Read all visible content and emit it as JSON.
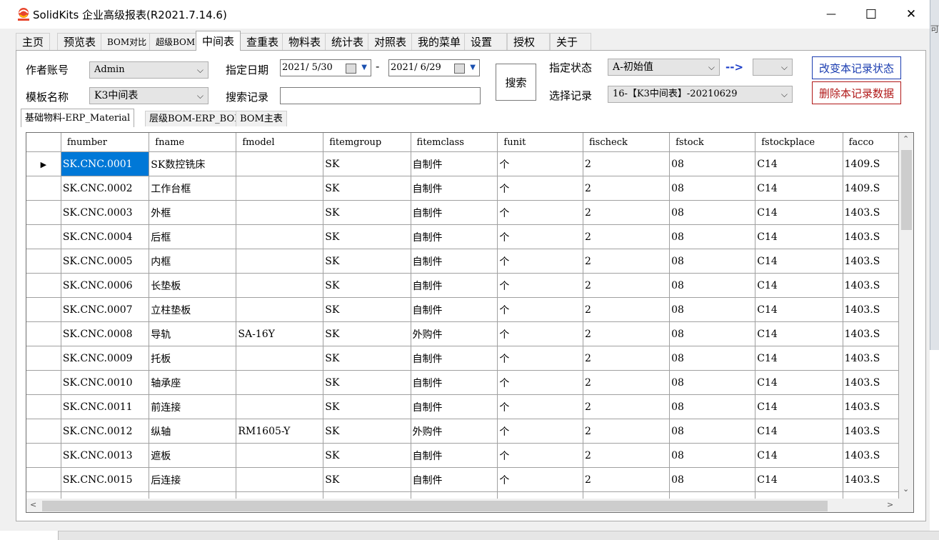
{
  "window": {
    "title": "SolidKits 企业高级报表(R2021.7.14.6)",
    "edge_text": "可",
    "minimize_glyph": "—",
    "maximize_glyph": "☐",
    "close_glyph": "✕"
  },
  "main_tabs": [
    {
      "label": "主页"
    },
    {
      "label": "预览表"
    },
    {
      "label": "BOM对比"
    },
    {
      "label": "超级BOM"
    },
    {
      "label": "中间表"
    },
    {
      "label": "查重表"
    },
    {
      "label": "物料表"
    },
    {
      "label": "统计表"
    },
    {
      "label": "对照表"
    },
    {
      "label": "我的菜单"
    },
    {
      "label": "设置"
    },
    {
      "label": "授权"
    },
    {
      "label": "关于"
    }
  ],
  "form": {
    "author_label": "作者账号",
    "author_value": "Admin",
    "template_label": "模板名称",
    "template_value": "K3中间表",
    "date_label": "指定日期",
    "date_from": "2021/ 5/30",
    "date_sep": "-",
    "date_to": "2021/ 6/29",
    "search_record_label": "搜索记录",
    "search_record_value": "",
    "search_button": "搜索",
    "status_label": "指定状态",
    "status_value": "A-初始值",
    "status_arrow": "-->",
    "status_target_value": "",
    "record_label": "选择记录",
    "record_value": "16-【K3中间表】-20210629",
    "change_status_button": "改变本记录状态",
    "delete_record_button": "删除本记录数据",
    "dropdown_arrow": "⌵"
  },
  "sub_tabs": [
    {
      "label": "基础物料-ERP_Material"
    },
    {
      "label": "层级BOM-ERP_BOM"
    },
    {
      "label": "BOM主表"
    }
  ],
  "grid": {
    "current_row_marker": "▶",
    "columns": [
      "fnumber",
      "fname",
      "fmodel",
      "fitemgroup",
      "fitemclass",
      "funit",
      "fischeck",
      "fstock",
      "fstockplace",
      "facco"
    ],
    "rows": [
      [
        "SK.CNC.0001",
        "SK数控铣床",
        "",
        "SK",
        "自制件",
        "个",
        "2",
        "08",
        "C14",
        "1409.S"
      ],
      [
        "SK.CNC.0002",
        "工作台框",
        "",
        "SK",
        "自制件",
        "个",
        "2",
        "08",
        "C14",
        "1409.S"
      ],
      [
        "SK.CNC.0003",
        "外框",
        "",
        "SK",
        "自制件",
        "个",
        "2",
        "08",
        "C14",
        "1403.S"
      ],
      [
        "SK.CNC.0004",
        "后框",
        "",
        "SK",
        "自制件",
        "个",
        "2",
        "08",
        "C14",
        "1403.S"
      ],
      [
        "SK.CNC.0005",
        "内框",
        "",
        "SK",
        "自制件",
        "个",
        "2",
        "08",
        "C14",
        "1403.S"
      ],
      [
        "SK.CNC.0006",
        "长垫板",
        "",
        "SK",
        "自制件",
        "个",
        "2",
        "08",
        "C14",
        "1403.S"
      ],
      [
        "SK.CNC.0007",
        "立柱垫板",
        "",
        "SK",
        "自制件",
        "个",
        "2",
        "08",
        "C14",
        "1403.S"
      ],
      [
        "SK.CNC.0008",
        "导轨",
        "SA-16Y",
        "SK",
        "外购件",
        "个",
        "2",
        "08",
        "C14",
        "1403.S"
      ],
      [
        "SK.CNC.0009",
        "托板",
        "",
        "SK",
        "自制件",
        "个",
        "2",
        "08",
        "C14",
        "1403.S"
      ],
      [
        "SK.CNC.0010",
        "轴承座",
        "",
        "SK",
        "自制件",
        "个",
        "2",
        "08",
        "C14",
        "1403.S"
      ],
      [
        "SK.CNC.0011",
        "前连接",
        "",
        "SK",
        "自制件",
        "个",
        "2",
        "08",
        "C14",
        "1403.S"
      ],
      [
        "SK.CNC.0012",
        "纵轴",
        "RM1605-Y",
        "SK",
        "外购件",
        "个",
        "2",
        "08",
        "C14",
        "1403.S"
      ],
      [
        "SK.CNC.0013",
        "遮板",
        "",
        "SK",
        "自制件",
        "个",
        "2",
        "08",
        "C14",
        "1403.S"
      ],
      [
        "SK.CNC.0015",
        "后连接",
        "",
        "SK",
        "自制件",
        "个",
        "2",
        "08",
        "C14",
        "1403.S"
      ],
      [
        "",
        "",
        "",
        "",
        "",
        "",
        "",
        "",
        "",
        ""
      ]
    ],
    "scroll_up": "⌃",
    "scroll_down": "⌄",
    "scroll_left": "<",
    "scroll_right": ">"
  }
}
